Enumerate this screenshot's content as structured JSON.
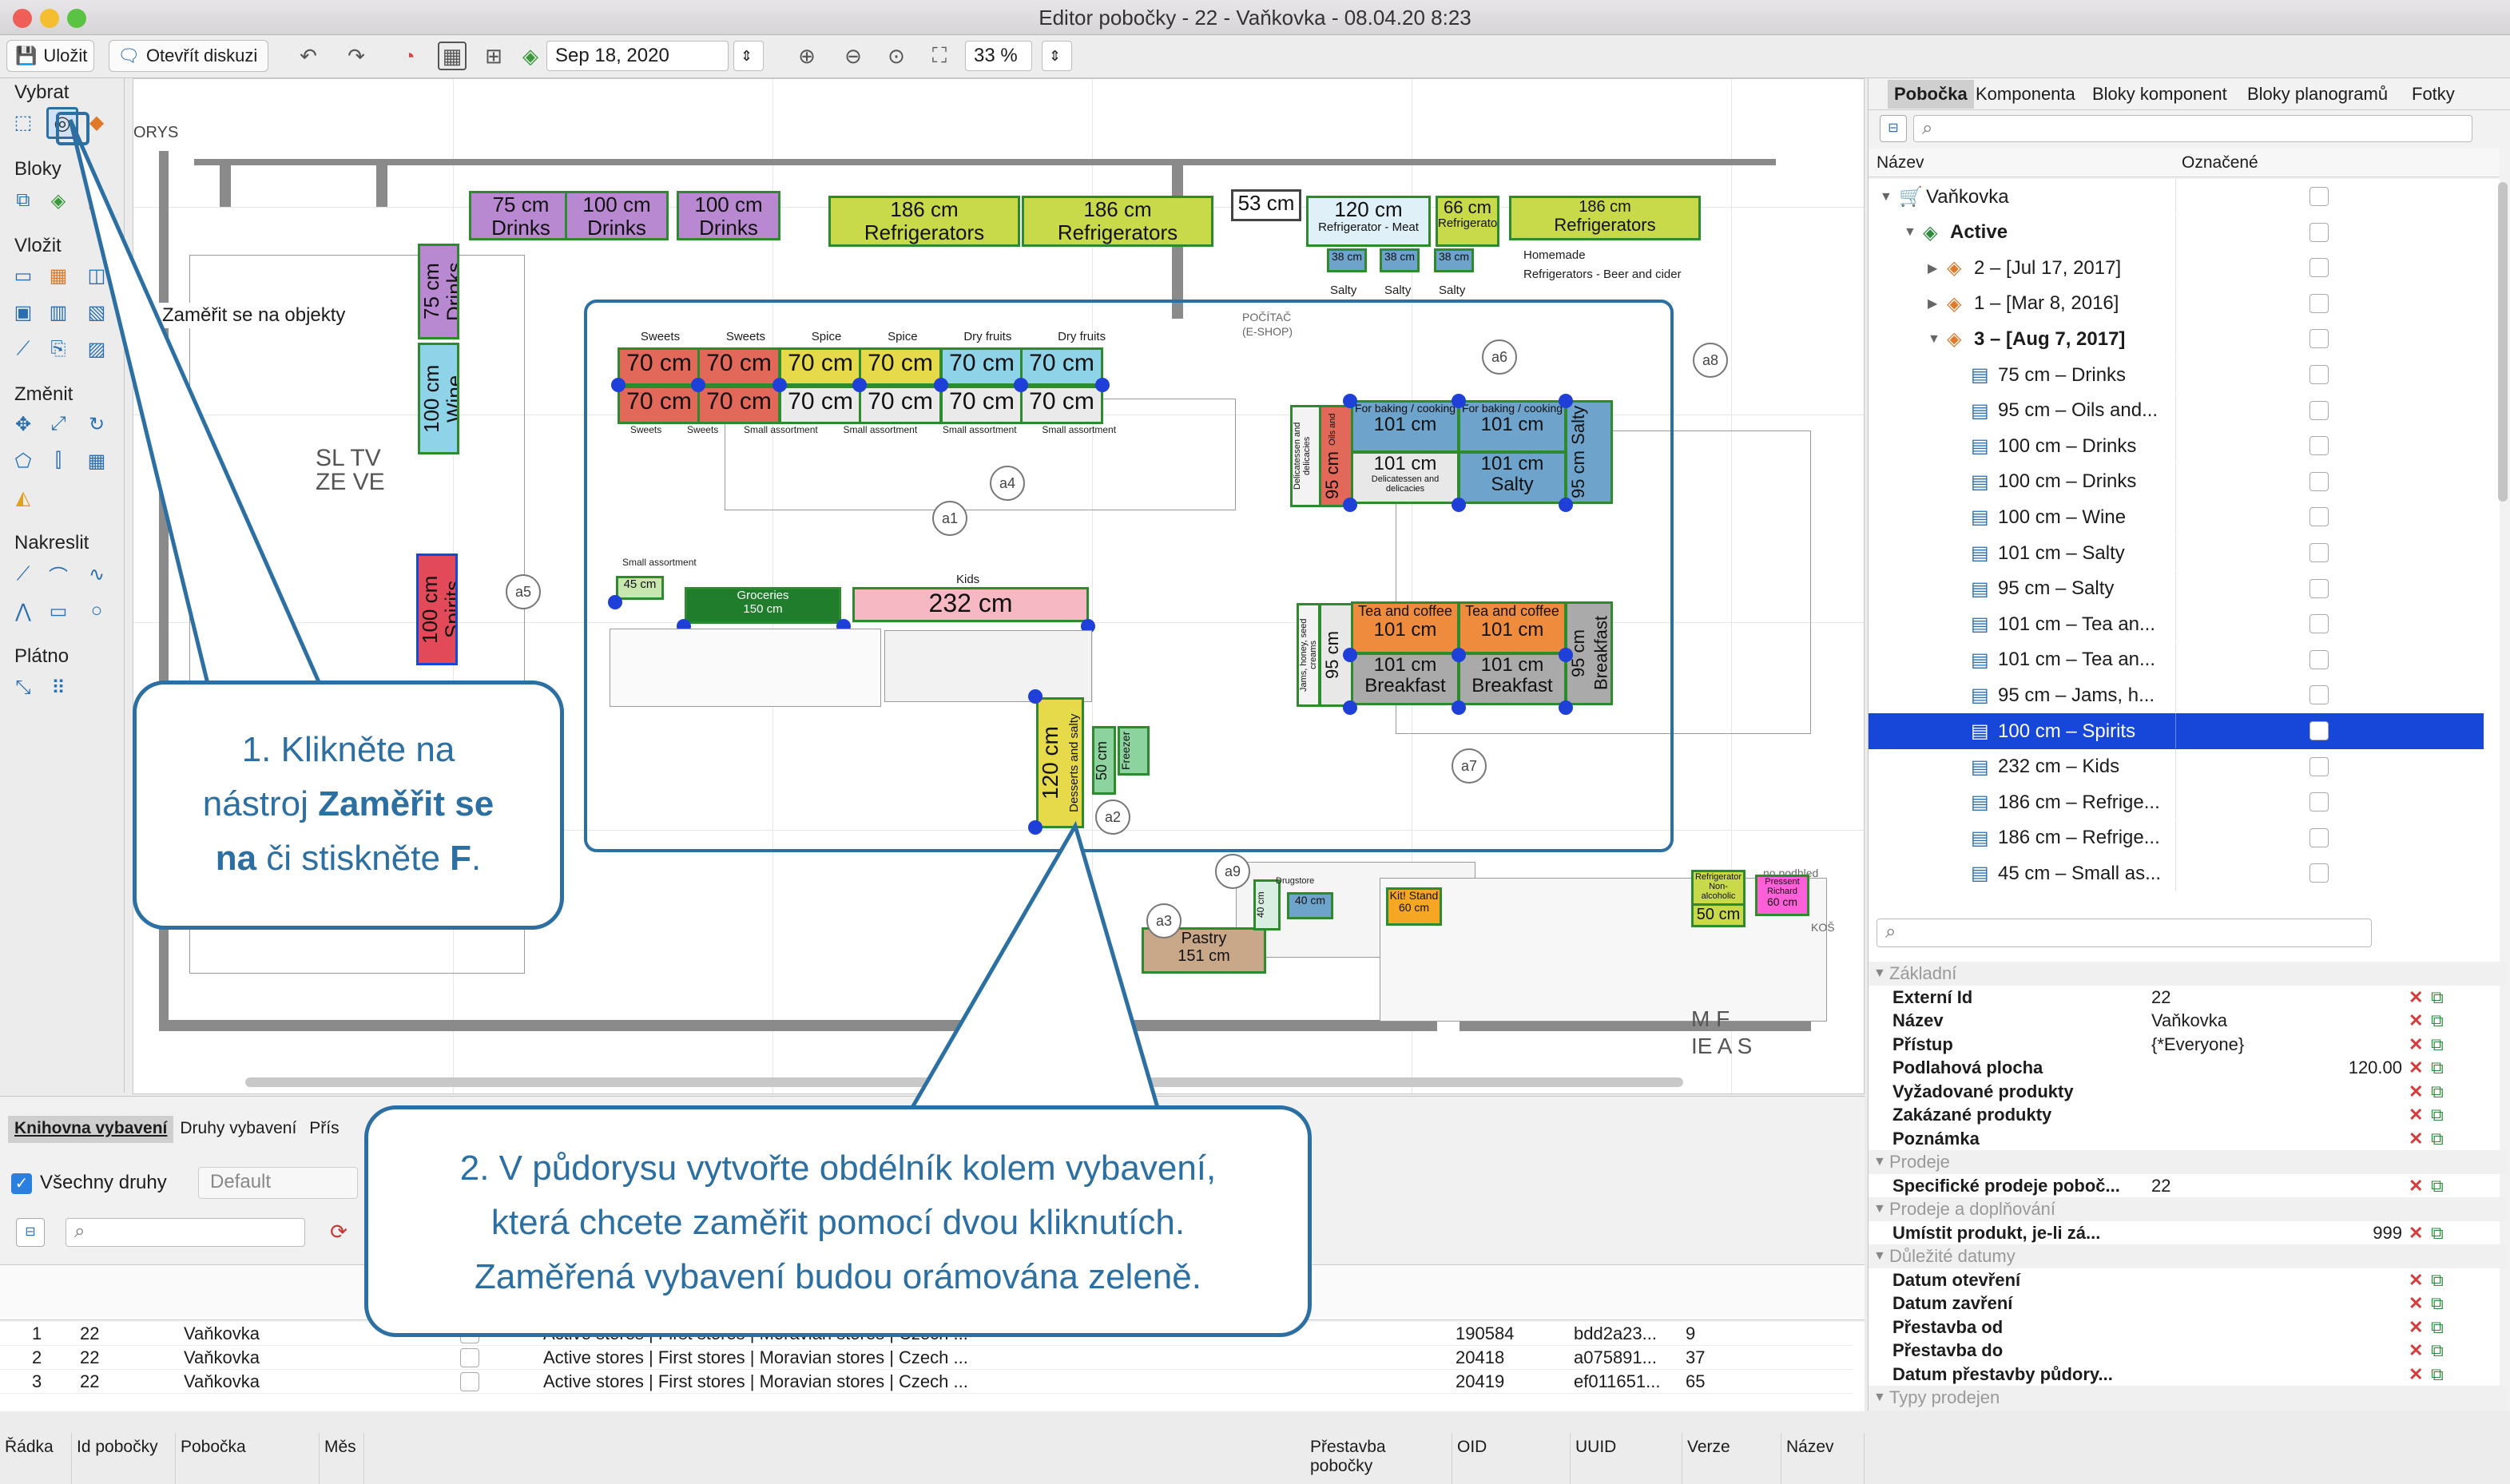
{
  "window": {
    "title": "Editor pobočky - 22 - Vaňkovka - 08.04.20 8:23"
  },
  "toolbar": {
    "save": "Uložit",
    "open_discussion": "Otevřít diskuzi",
    "date": "Sep 18, 2020",
    "zoom": "33 %"
  },
  "palette": {
    "select": "Vybrat",
    "blocks": "Bloky",
    "insert": "Vložit",
    "change": "Změnit",
    "draw": "Nakreslit",
    "canvas": "Plátno"
  },
  "canvas": {
    "label_plan": "ORYS",
    "tooltip": "Zaměřit se na objekty",
    "fixtures": {
      "drinks1": "75 cm",
      "drinks1_sub": "Drinks",
      "drinks2": "100 cm",
      "drinks2_sub": "Drinks",
      "drinks3": "100 cm",
      "drinks3_sub": "Drinks",
      "refr1": "186 cm",
      "refr1_sub": "Refrigerators",
      "refr2": "186 cm",
      "refr2_sub": "Refrigerators",
      "cm53": "53 cm",
      "refr_meat": "120 cm",
      "refr_meat_sub": "Refrigerator - Meat",
      "refr66": "66 cm",
      "refr66_sub": "Refrigerators",
      "refr_beer": "186 cm",
      "refr_beer_sub": "Refrigerators",
      "refr_beer_note": "Homemade",
      "refr_beer_note2": "Refrigerators - Beer and cider",
      "salty": "Salty",
      "cm38": "38 cm",
      "left_drinks": "75 cm",
      "left_drinks_sub": "Drinks",
      "left_wine": "100 cm",
      "left_wine_sub": "Wine",
      "spirits": "100 cm",
      "spirits_sub": "Spirits",
      "gondola_top_labels": [
        "Sweets",
        "Sweets",
        "Spice",
        "Spice",
        "Dry fruits",
        "Dry fruits"
      ],
      "gondola_bottom_labels": [
        "Sweets",
        "Sweets",
        "Small assortment",
        "Small assortment",
        "Small assortment",
        "Small assortment"
      ],
      "seventy": "70 cm",
      "groceries": "Groceries",
      "groceries_sub": "150 cm",
      "small_as": "45 cm",
      "small_as_label": "Small assortment",
      "kids_label": "Kids",
      "kids": "232 cm",
      "desserts": "120 cm",
      "desserts_sub": "Desserts and salty",
      "freezer": "50 cm",
      "freezer_sub": "Freezer",
      "oils": "95 cm",
      "oils_sub": "Oils and vinegars",
      "oils_side": "Delicatessen and delicacies",
      "baking1": "For baking / cooking",
      "baking1_val": "101 cm",
      "deli": "101 cm",
      "deli_sub": "Delicatessen and delicacies",
      "baking2": "For baking / cooking",
      "baking2_val": "101 cm",
      "salty2": "101 cm",
      "salty2_sub": "Salty",
      "salty3": "95 cm",
      "salty3_sub": "Salty",
      "jams": "95 cm",
      "jams_sub": "Jams, honey, seed creams",
      "tea1": "Tea and coffee",
      "tea1_val": "101 cm",
      "bf1": "101 cm",
      "bf1_sub": "Breakfast",
      "tea2": "Tea and coffee",
      "tea2_val": "101 cm",
      "bf2": "101 cm",
      "bf2_sub": "Breakfast",
      "bf3": "95 cm",
      "bf3_sub": "Breakfast",
      "pastry": "Pastry",
      "pastry_sub": "151 cm",
      "kit": "Kit! Stand",
      "kit_sub": "60 cm",
      "drugstore1": "40 cm",
      "drugstore2": "40 cm",
      "drugstore_label": "Drugstore",
      "refr_na": "Refrigerator",
      "refr_na_sub": "Non-alcoholic",
      "refr_na_val": "50 cm",
      "pressent": "Pressent Richard",
      "pressent_val": "60 cm",
      "pocitac": "POČÍTAČ",
      "eshop": "(E-SHOP)",
      "no_podhled": "no podhled",
      "kos": "KOŠ"
    },
    "markers": [
      "a1",
      "a2",
      "a3",
      "a4",
      "a5",
      "a6",
      "a7",
      "a8",
      "a9"
    ],
    "sl_labels": "SL TV ZE VE",
    "side_letters": "M F IE A S"
  },
  "right_panel": {
    "tabs": [
      "Pobočka",
      "Komponenta",
      "Bloky komponent",
      "Bloky planogramů",
      "Fotky"
    ],
    "tree_header": [
      "Název",
      "Označené"
    ],
    "tree": [
      {
        "label": "Vaňkovka",
        "indent": 0,
        "arrow": "▼",
        "icon": "cart"
      },
      {
        "label": "Active",
        "indent": 1,
        "arrow": "▼",
        "icon": "layers-green",
        "bold": true
      },
      {
        "label": "2 – [Jul 17, 2017]",
        "indent": 2,
        "arrow": "▶",
        "icon": "layers-orange"
      },
      {
        "label": "1 – [Mar 8, 2016]",
        "indent": 2,
        "arrow": "▶",
        "icon": "layers-orange"
      },
      {
        "label": "3 – [Aug 7, 2017]",
        "indent": 2,
        "arrow": "▼",
        "icon": "layers-orange",
        "bold": true
      },
      {
        "label": "75 cm – Drinks",
        "indent": 3,
        "icon": "shelf"
      },
      {
        "label": "95 cm – Oils and...",
        "indent": 3,
        "icon": "shelf"
      },
      {
        "label": "100 cm – Drinks",
        "indent": 3,
        "icon": "shelf"
      },
      {
        "label": "100 cm – Drinks",
        "indent": 3,
        "icon": "shelf"
      },
      {
        "label": "100 cm – Wine",
        "indent": 3,
        "icon": "shelf"
      },
      {
        "label": "101 cm – Salty",
        "indent": 3,
        "icon": "shelf"
      },
      {
        "label": "95 cm – Salty",
        "indent": 3,
        "icon": "shelf"
      },
      {
        "label": "101 cm – Tea an...",
        "indent": 3,
        "icon": "shelf"
      },
      {
        "label": "101 cm – Tea an...",
        "indent": 3,
        "icon": "shelf"
      },
      {
        "label": "95 cm – Jams, h...",
        "indent": 3,
        "icon": "shelf"
      },
      {
        "label": "100 cm – Spirits",
        "indent": 3,
        "icon": "shelf",
        "selected": true
      },
      {
        "label": "232 cm – Kids",
        "indent": 3,
        "icon": "shelf"
      },
      {
        "label": "186 cm – Refrige...",
        "indent": 3,
        "icon": "shelf"
      },
      {
        "label": "186 cm – Refrige...",
        "indent": 3,
        "icon": "shelf"
      },
      {
        "label": "45 cm – Small as...",
        "indent": 3,
        "icon": "shelf"
      }
    ],
    "props": [
      {
        "type": "section",
        "label": "Základní"
      },
      {
        "label": "Externí Id",
        "value": "22",
        "align": "left"
      },
      {
        "label": "Název",
        "value": "Vaňkovka",
        "align": "left"
      },
      {
        "label": "Přístup",
        "value": "{*Everyone}",
        "align": "left"
      },
      {
        "label": "Podlahová plocha",
        "value": "120.00",
        "align": "right"
      },
      {
        "label": "Vyžadované produkty",
        "value": "",
        "align": "left"
      },
      {
        "label": "Zakázané produkty",
        "value": "",
        "align": "left"
      },
      {
        "label": "Poznámka",
        "value": "",
        "align": "left"
      },
      {
        "type": "section",
        "label": "Prodeje"
      },
      {
        "label": "Specifické prodeje poboč...",
        "value": "22",
        "align": "left"
      },
      {
        "type": "section",
        "label": "Prodeje a doplňování"
      },
      {
        "label": "Umístit produkt, je-li zá...",
        "value": "999",
        "align": "right"
      },
      {
        "type": "section",
        "label": "Důležité datumy"
      },
      {
        "label": "Datum otevření",
        "value": "",
        "align": "left"
      },
      {
        "label": "Datum zavření",
        "value": "",
        "align": "left"
      },
      {
        "label": "Přestavba od",
        "value": "",
        "align": "left"
      },
      {
        "label": "Přestavba do",
        "value": "",
        "align": "left"
      },
      {
        "label": "Datum přestavby půdory...",
        "value": "",
        "align": "left"
      },
      {
        "type": "section",
        "label": "Typy prodejen"
      }
    ]
  },
  "bottom_panel": {
    "tabs": [
      "Knihovna vybavení",
      "Druhy vybavení",
      "Přís"
    ],
    "all_kinds": "Všechny druhy",
    "default": "Default",
    "columns": [
      "Řádka",
      "Id pobočky",
      "Pobočka",
      "Měs",
      "Přestavba pobočky",
      "OID",
      "UUID",
      "Verze",
      "Název"
    ],
    "rows": [
      {
        "n": "1",
        "id": "22",
        "branch": "Vaňkovka",
        "path": "Active stores | First stores | Moravian stores | Czech ...",
        "oid": "190584",
        "uuid": "bdd2a23...",
        "ver": "9"
      },
      {
        "n": "2",
        "id": "22",
        "branch": "Vaňkovka",
        "path": "Active stores | First stores | Moravian stores | Czech ...",
        "oid": "20418",
        "uuid": "a075891...",
        "ver": "37"
      },
      {
        "n": "3",
        "id": "22",
        "branch": "Vaňkovka",
        "path": "Active stores | First stores | Moravian stores | Czech ...",
        "oid": "20419",
        "uuid": "ef011651...",
        "ver": "65"
      }
    ]
  },
  "callouts": {
    "c1_a": "1. Klikněte na",
    "c1_b": "nástroj ",
    "c1_bold1": "Zaměřit se",
    "c1_bold2": "na",
    "c1_c": " či stiskněte ",
    "c1_bold3": "F",
    "c1_d": ".",
    "c2_a": "2. V půdorysu vytvořte obdélník kolem vybavení,",
    "c2_b": "která chcete zaměřit pomocí dvou kliknutích.",
    "c2_c": "Zaměřená vybavení budou orámována zeleně."
  },
  "colors": {
    "accent": "#2b6fa3",
    "selection": "#1747d8",
    "fixture_border": "#2d8a2d",
    "red_fixture": "#e2685a",
    "yellow_fixture": "#e6d94a",
    "blue_fixture": "#6ea3cc",
    "orange_fixture": "#ef8b3c",
    "purple_fixture": "#b888d0",
    "lime_fixture": "#c8d94a"
  }
}
